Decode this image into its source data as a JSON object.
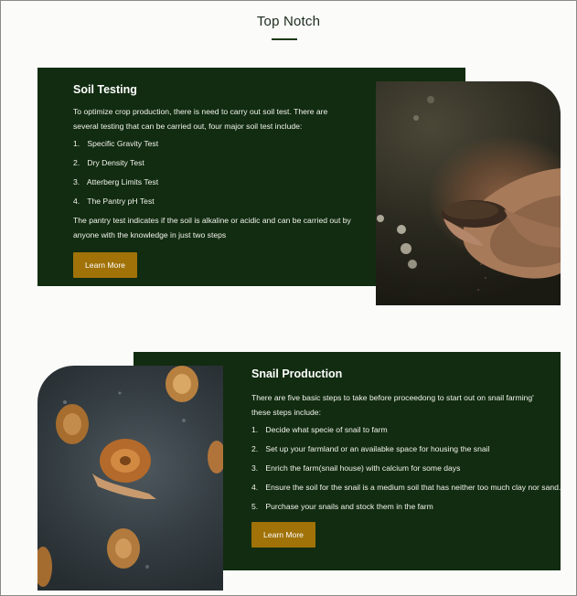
{
  "section": {
    "title": "Top Notch"
  },
  "soil": {
    "heading": "Soil Testing",
    "intro_line1": "To optimize crop production, there is need to carry out soil test. There are",
    "intro_line2": "several testing that can be carried out, four major soil test include:",
    "items": [
      {
        "num": "1.",
        "label": "Specific Gravity Test"
      },
      {
        "num": "2.",
        "label": "Dry Density Test"
      },
      {
        "num": "3.",
        "label": "Atterberg Limits Test"
      },
      {
        "num": "4.",
        "label": "The Pantry pH Test"
      }
    ],
    "outro_line1": "The pantry test indicates if the soil is alkaline or acidic and can be carried out by",
    "outro_line2": "anyone with the knowledge in just two steps",
    "button": "Learn More"
  },
  "snail": {
    "heading": "Snail Production",
    "intro_line1": "There are five basic steps to take before proceedong to start out on snail farming'",
    "intro_line2": "these steps include:",
    "items": [
      {
        "num": "1.",
        "label": "Decide what specie of snail to farm"
      },
      {
        "num": "2.",
        "label": "Set up your farmland or an availabke space for housing the snail"
      },
      {
        "num": "3.",
        "label": "Enrich the farm(snail house) with calcium for some days"
      },
      {
        "num": "4.",
        "label": "Ensure the soil for the snail is a medium soil that has neither too much clay nor sand."
      },
      {
        "num": "5.",
        "label": "Purchase your snails and stock them  in the farm"
      }
    ],
    "button": "Learn More"
  },
  "colors": {
    "card_bg": "#112c10",
    "button_bg": "#a07208",
    "title_text": "#1b2b1b"
  }
}
